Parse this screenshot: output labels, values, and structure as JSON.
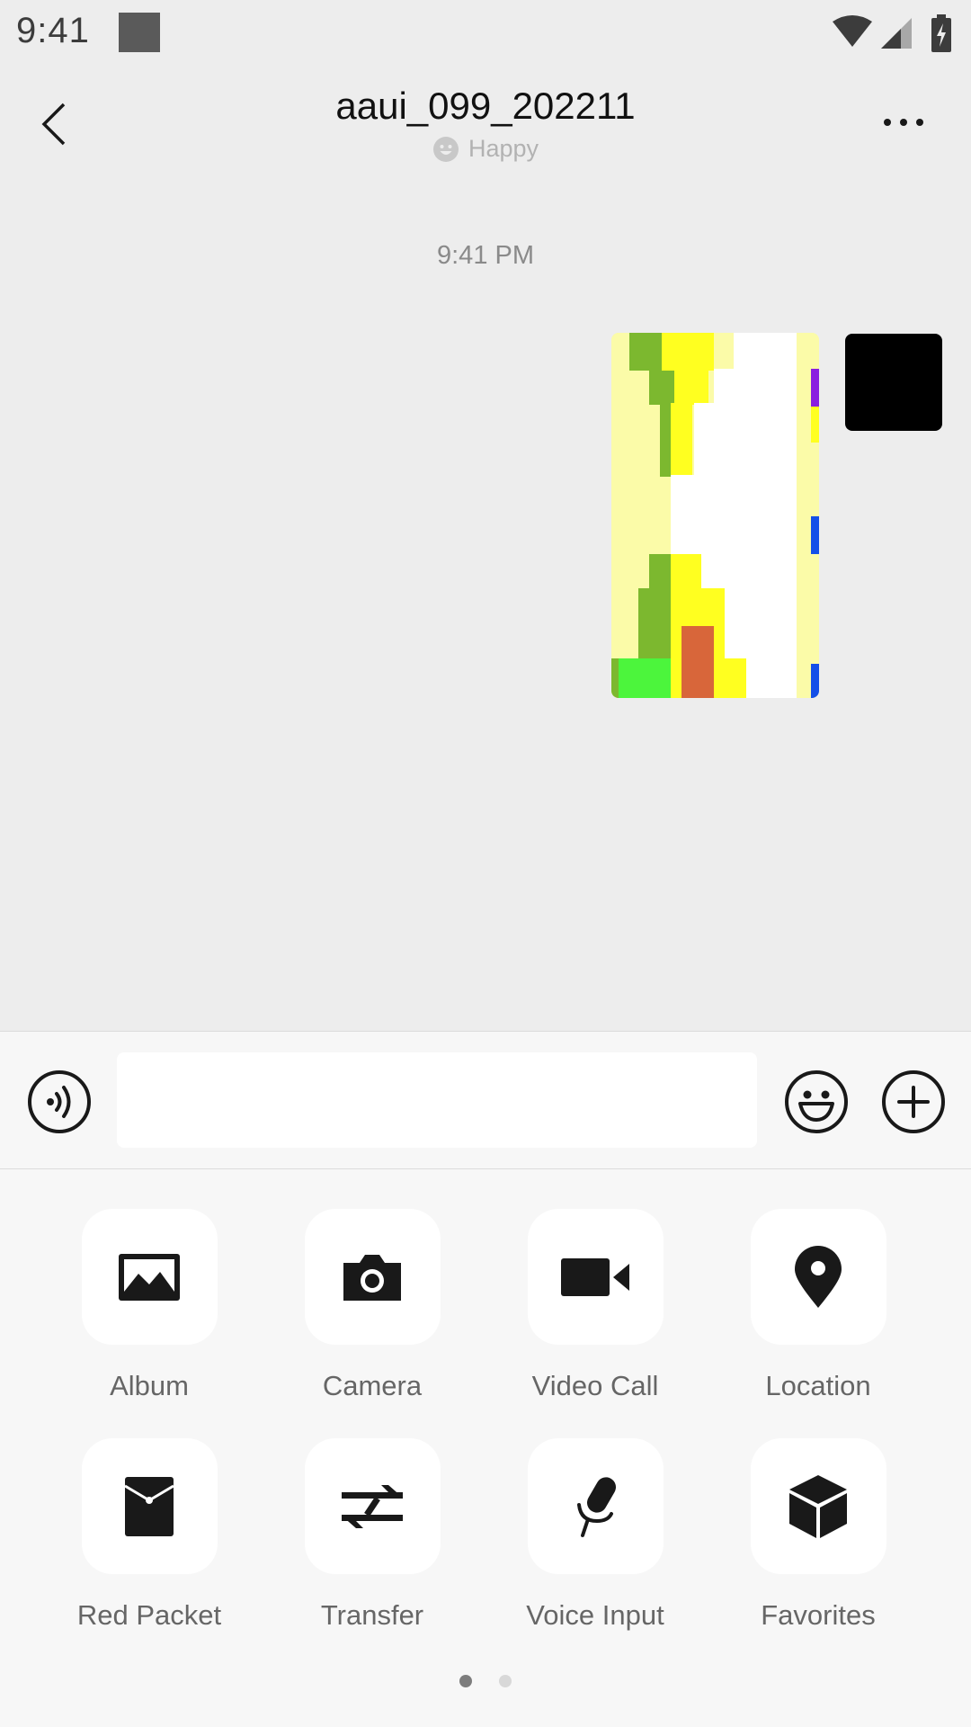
{
  "status_bar": {
    "time": "9:41"
  },
  "header": {
    "title": "aaui_099_202211",
    "status_text": "Happy"
  },
  "chat": {
    "timestamp": "9:41 PM",
    "messages": [
      {
        "sender": "self",
        "type": "image"
      }
    ]
  },
  "input_bar": {
    "message_placeholder": "",
    "message_value": ""
  },
  "panel": {
    "tools": [
      {
        "label": "Album",
        "icon": "album-icon"
      },
      {
        "label": "Camera",
        "icon": "camera-icon"
      },
      {
        "label": "Video Call",
        "icon": "video-call-icon"
      },
      {
        "label": "Location",
        "icon": "location-pin-icon"
      },
      {
        "label": "Red Packet",
        "icon": "red-packet-icon"
      },
      {
        "label": "Transfer",
        "icon": "transfer-icon"
      },
      {
        "label": "Voice Input",
        "icon": "microphone-icon"
      },
      {
        "label": "Favorites",
        "icon": "cube-icon"
      }
    ],
    "pages": {
      "current": 1,
      "total": 2
    }
  },
  "colors": {
    "background": "#ededed",
    "panel_background": "#f7f7f7",
    "icon": "#191919",
    "label": "#666666",
    "status_text": "#b2b2b2"
  }
}
